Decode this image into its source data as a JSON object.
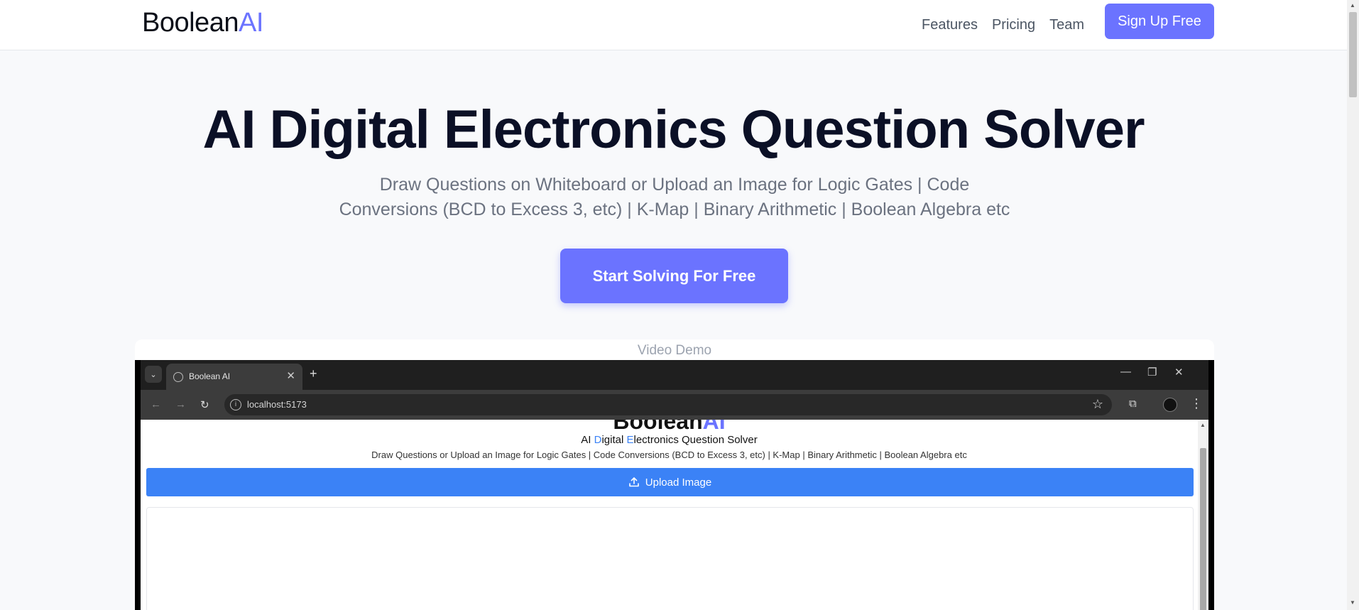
{
  "brand": {
    "name_main": "Boolean",
    "name_accent": "AI"
  },
  "nav": {
    "links": [
      "Features",
      "Pricing",
      "Team"
    ],
    "signup_label": "Sign Up Free"
  },
  "hero": {
    "title": "AI Digital Electronics Question Solver",
    "subtitle_line1": "Draw Questions on Whiteboard or Upload an Image for Logic Gates | Code",
    "subtitle_line2": "Conversions (BCD to Excess 3, etc) | K-Map | Binary Arithmetic | Boolean Algebra etc",
    "cta_label": "Start Solving For Free"
  },
  "demo": {
    "label": "Video Demo",
    "browser": {
      "tab_title": "Boolean AI",
      "url": "localhost:5173",
      "icons": [
        "tab-dropdown-icon",
        "globe-icon",
        "close-icon",
        "plus-icon",
        "minimize-icon",
        "restore-icon",
        "window-close-icon",
        "back-icon",
        "forward-icon",
        "reload-icon",
        "info-icon",
        "star-icon",
        "extensions-icon",
        "profile-icon",
        "menu-dots-icon"
      ]
    },
    "inner_app": {
      "logo_main": "Boolean",
      "logo_accent": "AI",
      "title_parts": [
        "AI ",
        "D",
        "igital ",
        "E",
        "lectronics Question Solver"
      ],
      "subtitle": "Draw Questions or Upload an Image for Logic Gates | Code Conversions (BCD to Excess 3, etc) | K-Map | Binary Arithmetic | Boolean Algebra etc",
      "upload_label": "Upload Image"
    }
  },
  "colors": {
    "accent": "#6b73ff",
    "heading": "#0b1026",
    "upload_blue": "#3b82f6",
    "page_bg": "#f8f9fb"
  }
}
